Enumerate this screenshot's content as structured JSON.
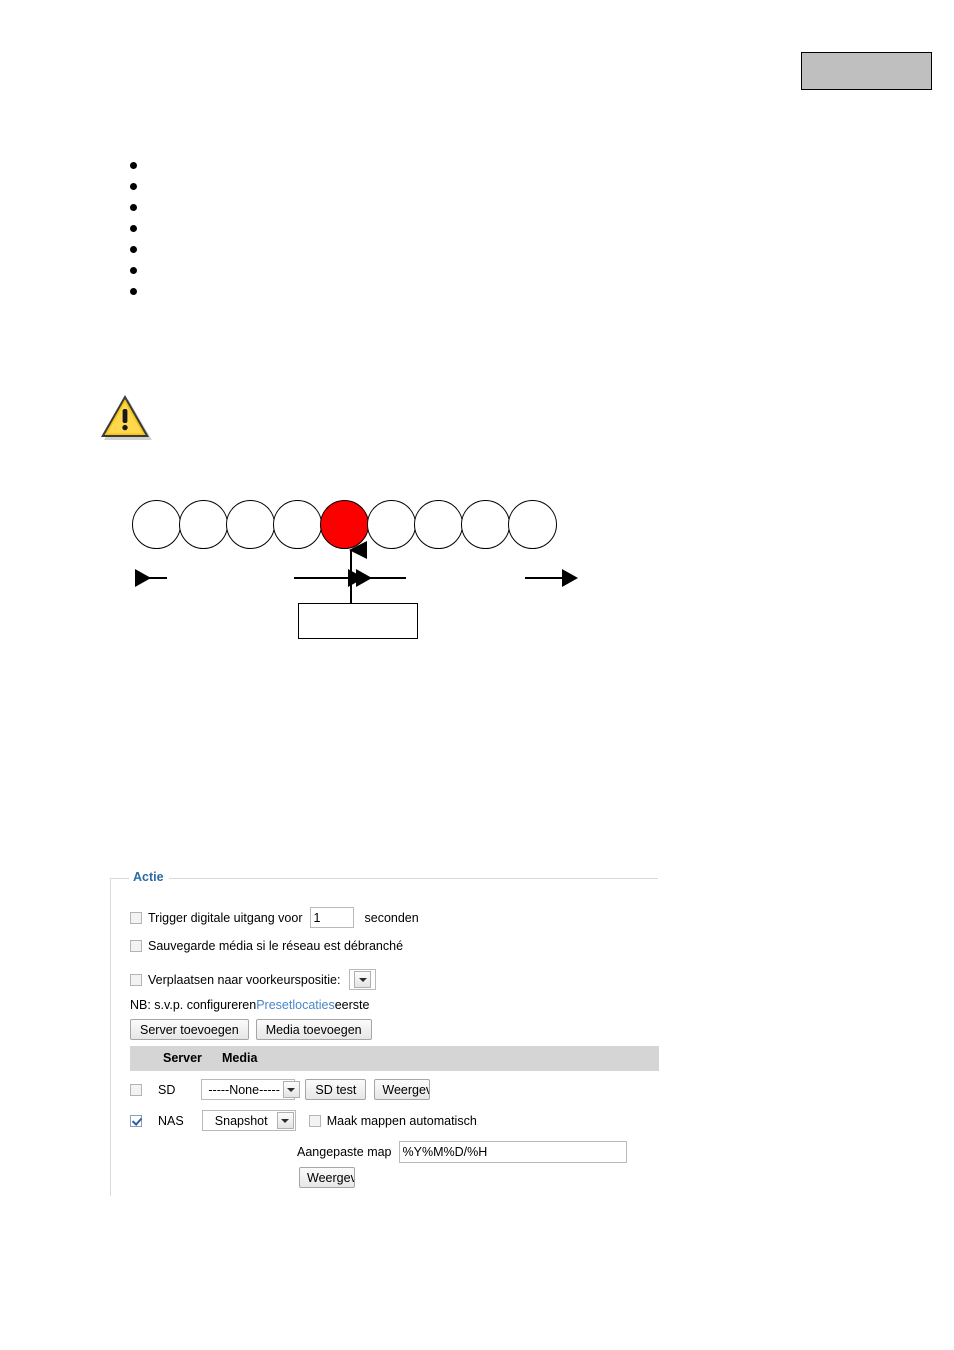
{
  "page": {
    "header_box": "",
    "bullets": [
      "",
      "",
      "",
      "",
      "",
      "",
      ""
    ],
    "warning_icon": "warning-triangle-icon",
    "diagram": {
      "circle_count": 9,
      "highlighted_index": 4,
      "highlight_color": "#fc0000",
      "callout_text": "",
      "left_arrow": "arrow-left-icon",
      "right_arrow": "arrow-right-icon",
      "center_arrows": "converging-arrows-icon",
      "pointer_arrow": "arrow-up-icon"
    }
  },
  "action_panel": {
    "legend": "Actie",
    "trigger_output": {
      "label": "Trigger digitale uitgang voor",
      "value": "1",
      "unit": "seconden",
      "checked": false
    },
    "backup_media": {
      "label": "Sauvegarde média si le réseau est débranché",
      "checked": false
    },
    "move_preset": {
      "label": "Verplaatsen naar voorkeurspositie:",
      "selected": "",
      "checked": false
    },
    "note": {
      "prefix": "NB: s.v.p. configureren ",
      "link": "Presetlocaties",
      "suffix": " eerste"
    },
    "buttons": {
      "add_server": "Server toevoegen",
      "add_media": "Media toevoegen"
    },
    "table": {
      "columns": [
        "",
        "Server",
        "Media",
        ""
      ],
      "rows": [
        {
          "checked": false,
          "server": "SD",
          "media_selected": "-----None-----",
          "test_button": "SD test",
          "view_button": "Weergev"
        },
        {
          "checked": true,
          "server": "NAS",
          "media_selected": "Snapshot",
          "auto_folder_label": "Maak mappen automatisch",
          "auto_folder_checked": false,
          "custom_folder_label": "Aangepaste map",
          "custom_folder_value": "%Y%M%D/%H",
          "view_button": "Weergev"
        }
      ]
    }
  },
  "colors": {
    "legend_blue": "#2b6ca3",
    "link_blue": "#4a86c8",
    "highlight_red": "#fc0000",
    "header_gray": "#bfbfbf",
    "table_header_gray": "#d5d5d5"
  }
}
